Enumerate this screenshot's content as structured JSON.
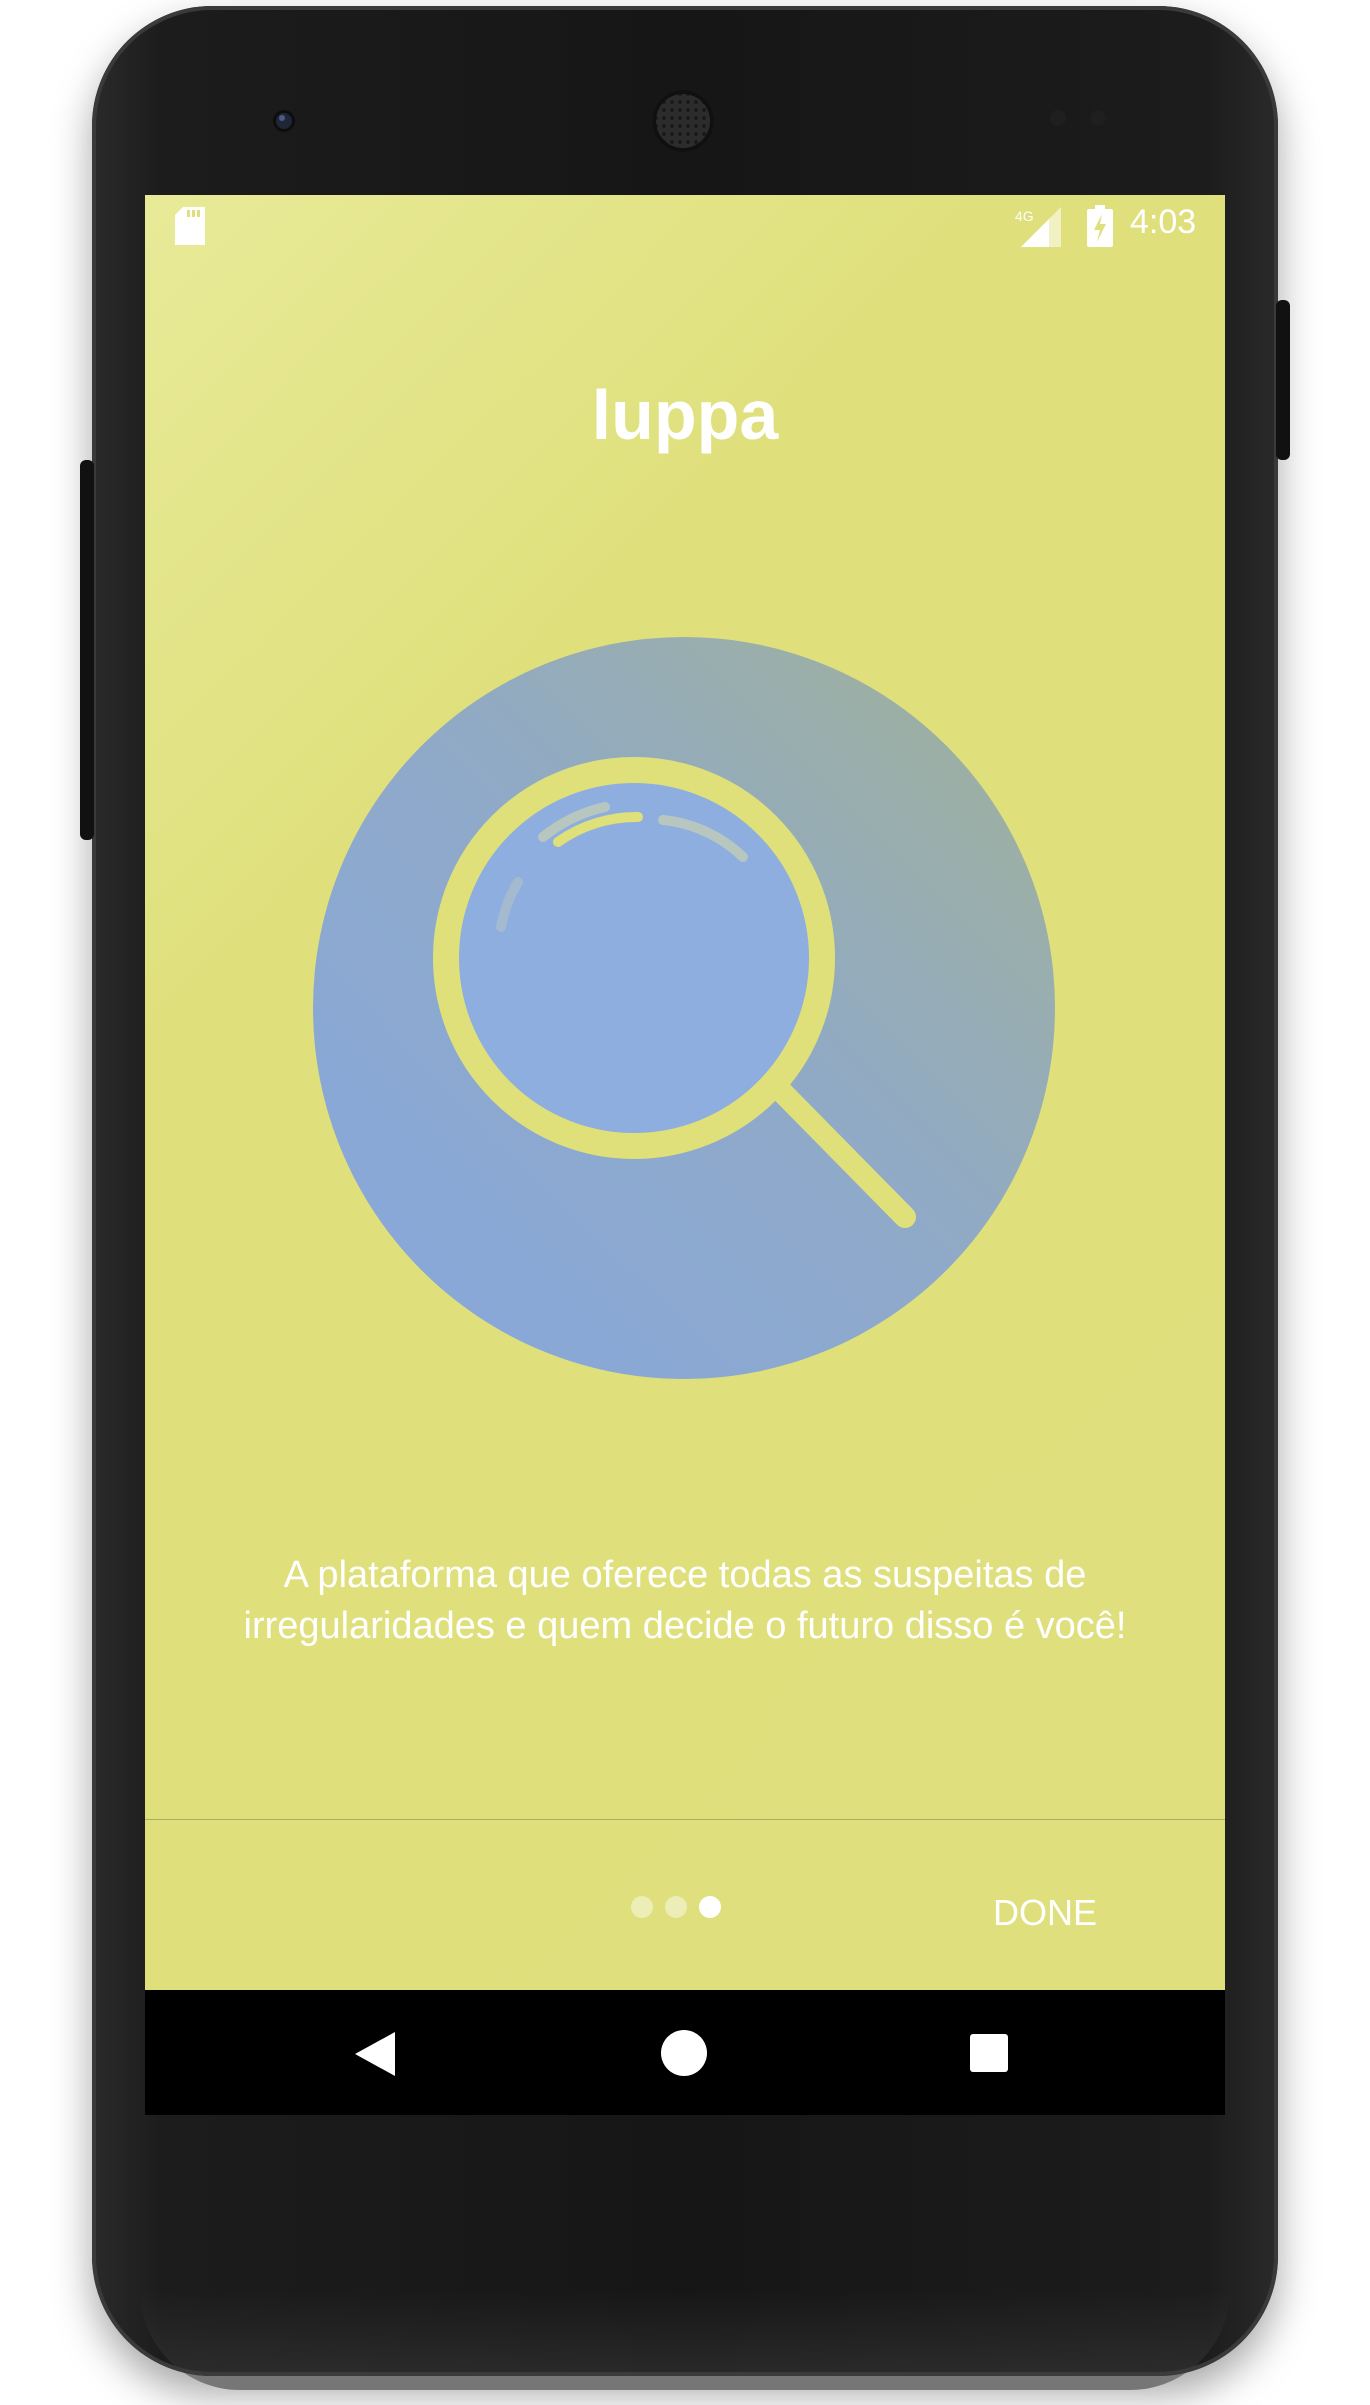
{
  "status_bar": {
    "time": "4:03",
    "network_label": "4G",
    "icons": [
      "sd-card-icon",
      "signal-icon",
      "battery-charging-icon"
    ]
  },
  "app": {
    "title": "luppa",
    "illustration_icon": "magnifying-glass-icon",
    "description_line1": "A plataforma que oferece todas as suspeitas de",
    "description_line2": "irregularidades e quem decide o futuro disso é você!"
  },
  "pager": {
    "page_count": 3,
    "active_index": 3,
    "done_label": "DONE"
  },
  "navigation": {
    "icons": [
      "back-icon",
      "home-icon",
      "recents-icon"
    ]
  },
  "colors": {
    "background": "#dfe07d",
    "circle_blue": "#88a8d8",
    "circle_gray": "#9aad9a",
    "lens": "#8daedf",
    "text": "#ffffff"
  }
}
